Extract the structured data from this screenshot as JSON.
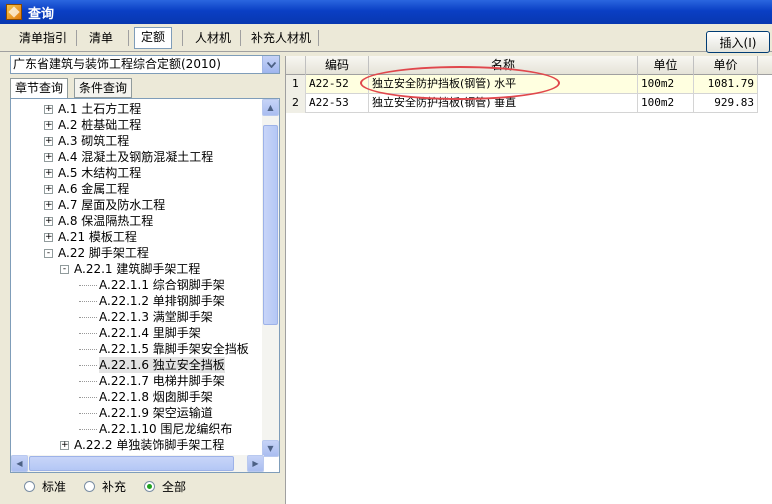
{
  "window": {
    "title": "查询"
  },
  "tabs": [
    {
      "label": "清单指引",
      "active": false
    },
    {
      "label": "清单",
      "active": false
    },
    {
      "label": "定额",
      "active": true
    },
    {
      "label": "人材机",
      "active": false
    },
    {
      "label": "补充人材机",
      "active": false
    }
  ],
  "toolbar": {
    "insert_label": "插入(I)"
  },
  "left": {
    "quota_library": "广东省建筑与装饰工程综合定额(2010)",
    "search_tabs": [
      {
        "label": "章节查询",
        "active": true
      },
      {
        "label": "条件查询",
        "active": false
      }
    ],
    "tree": [
      {
        "label": "A.1 土石方工程",
        "level": 0,
        "expander": "+"
      },
      {
        "label": "A.2 桩基础工程",
        "level": 0,
        "expander": "+"
      },
      {
        "label": "A.3 砌筑工程",
        "level": 0,
        "expander": "+"
      },
      {
        "label": "A.4 混凝土及钢筋混凝土工程",
        "level": 0,
        "expander": "+"
      },
      {
        "label": "A.5 木结构工程",
        "level": 0,
        "expander": "+"
      },
      {
        "label": "A.6 金属工程",
        "level": 0,
        "expander": "+"
      },
      {
        "label": "A.7 屋面及防水工程",
        "level": 0,
        "expander": "+"
      },
      {
        "label": "A.8 保温隔热工程",
        "level": 0,
        "expander": "+"
      },
      {
        "label": "A.21 模板工程",
        "level": 0,
        "expander": "+"
      },
      {
        "label": "A.22 脚手架工程",
        "level": 0,
        "expander": "-"
      },
      {
        "label": "A.22.1 建筑脚手架工程",
        "level": 1,
        "expander": "-"
      },
      {
        "label": "A.22.1.1 综合钢脚手架",
        "level": 2,
        "expander": ""
      },
      {
        "label": "A.22.1.2 单排钢脚手架",
        "level": 2,
        "expander": ""
      },
      {
        "label": "A.22.1.3 满堂脚手架",
        "level": 2,
        "expander": ""
      },
      {
        "label": "A.22.1.4 里脚手架",
        "level": 2,
        "expander": ""
      },
      {
        "label": "A.22.1.5 靠脚手架安全挡板",
        "level": 2,
        "expander": ""
      },
      {
        "label": "A.22.1.6 独立安全挡板",
        "level": 2,
        "expander": "",
        "selected": true
      },
      {
        "label": "A.22.1.7 电梯井脚手架",
        "level": 2,
        "expander": ""
      },
      {
        "label": "A.22.1.8 烟囱脚手架",
        "level": 2,
        "expander": ""
      },
      {
        "label": "A.22.1.9 架空运输道",
        "level": 2,
        "expander": ""
      },
      {
        "label": "A.22.1.10 围尼龙编织布",
        "level": 2,
        "expander": ""
      },
      {
        "label": "A.22.2 单独装饰脚手架工程",
        "level": 1,
        "expander": "+"
      }
    ],
    "filters": [
      {
        "label": "标准",
        "checked": false
      },
      {
        "label": "补充",
        "checked": false
      },
      {
        "label": "全部",
        "checked": true
      }
    ]
  },
  "grid": {
    "columns": [
      "",
      "编码",
      "名称",
      "单位",
      "单价"
    ],
    "rows": [
      {
        "num": "1",
        "code": "A22-52",
        "name": "独立安全防护挡板(钢管) 水平",
        "unit": "100m2",
        "price": "1081.79"
      },
      {
        "num": "2",
        "code": "A22-53",
        "name": "独立安全防护挡板(钢管) 垂直",
        "unit": "100m2",
        "price": "929.83"
      }
    ]
  },
  "colors": {
    "titlebar": "#0a3fc4",
    "selected_row": "#ffffe0",
    "annotation": "#e0474c",
    "radio_checked": "#21a121"
  }
}
